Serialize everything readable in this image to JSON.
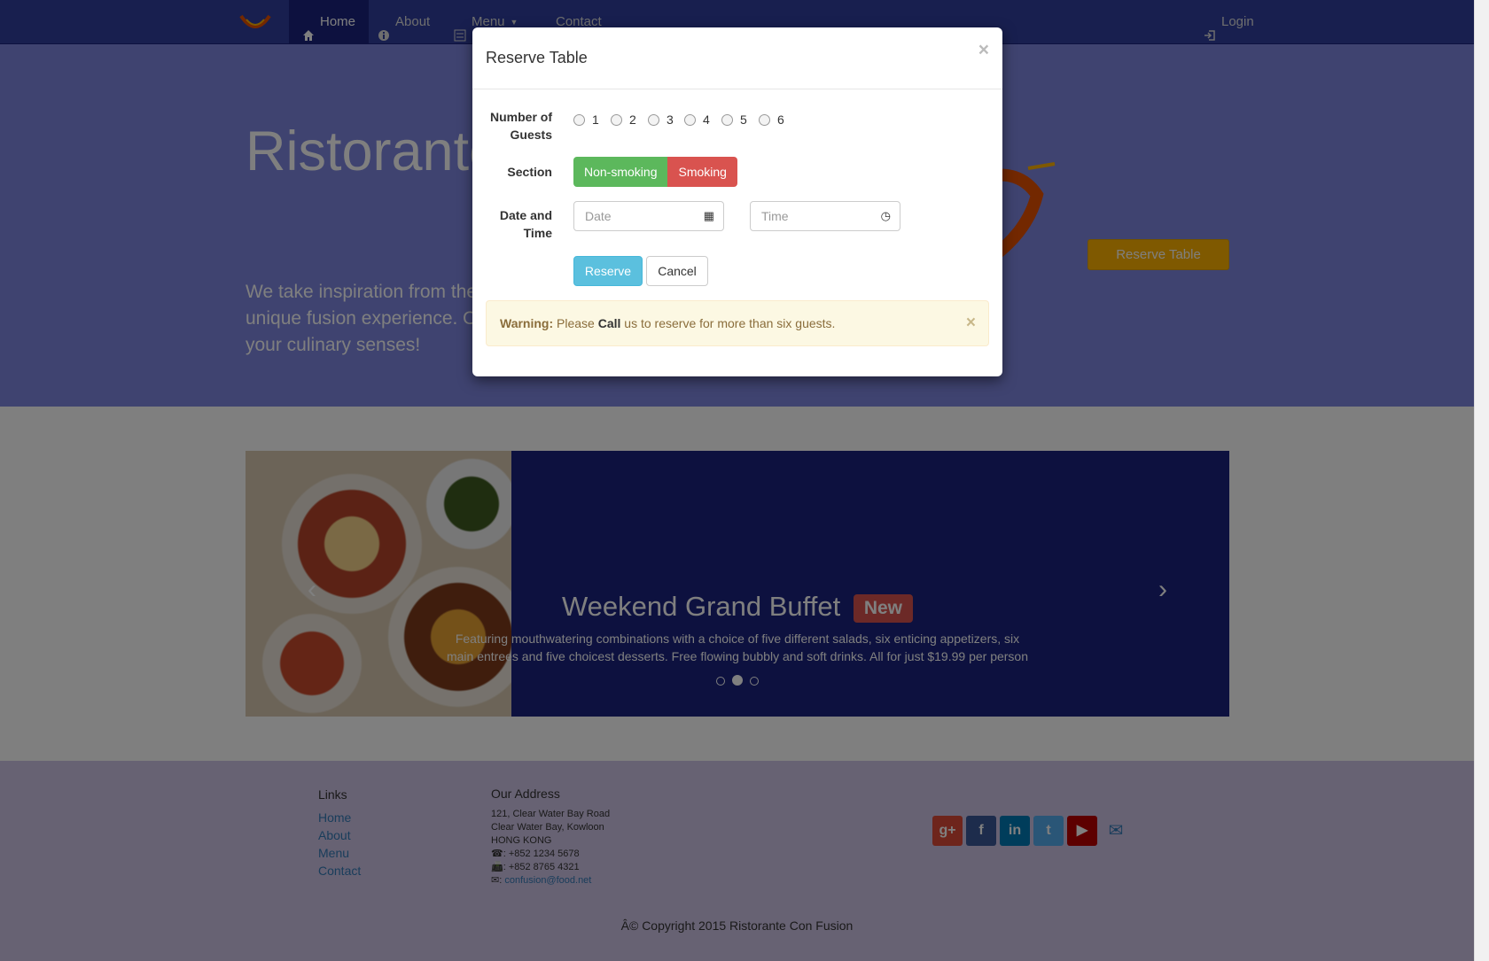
{
  "navbar": {
    "items": [
      {
        "label": "Home",
        "icon": "home-icon"
      },
      {
        "label": "About",
        "icon": "info-icon"
      },
      {
        "label": "Menu",
        "icon": "list-icon"
      },
      {
        "label": "Contact",
        "icon": "envelope-icon"
      }
    ],
    "login": "Login"
  },
  "jumbotron": {
    "title": "Ristorante Con Fusion",
    "text": "We take inspiration from the World's best cuisines, and create a unique fusion experience. Our lipsmacking creations will tickle your culinary senses!",
    "reserve_button": "Reserve Table"
  },
  "carousel": {
    "title": "Weekend Grand Buffet",
    "badge": "New",
    "text": "Featuring mouthwatering combinations with a choice of five different salads, six enticing appetizers, six main entrees and five choicest desserts. Free flowing bubbly and soft drinks. All for just $19.99 per person"
  },
  "footer": {
    "links_heading": "Links",
    "links": [
      "Home",
      "About",
      "Menu",
      "Contact"
    ],
    "address_heading": "Our Address",
    "address": [
      "121, Clear Water Bay Road",
      "Clear Water Bay, Kowloon",
      "HONG KONG"
    ],
    "phone": ": +852 1234 5678",
    "fax": ": +852 8765 4321",
    "email": "confusion@food.net",
    "copyright": "Â© Copyright 2015 Ristorante Con Fusion",
    "social": [
      "google-plus-icon",
      "facebook-icon",
      "linkedin-icon",
      "twitter-icon",
      "youtube-icon",
      "envelope-icon"
    ]
  },
  "modal": {
    "title": "Reserve Table",
    "close": "×",
    "guests_label": "Number of Guests",
    "guest_options": [
      "1",
      "2",
      "3",
      "4",
      "5",
      "6"
    ],
    "section_label": "Section",
    "section_options": [
      "Non-smoking",
      "Smoking"
    ],
    "datetime_label": "Date and Time",
    "date_placeholder": "Date",
    "time_placeholder": "Time",
    "reserve": "Reserve",
    "cancel": "Cancel",
    "alert": {
      "strong": "Warning:",
      "pre": " Please ",
      "call": "Call",
      "post": " us to reserve for more than six guests."
    }
  },
  "colors": {
    "primary": "#303f9f",
    "dark": "#1a237e",
    "accent": "#ffb300",
    "success": "#5cb85c",
    "danger": "#d9534f",
    "info": "#5bc0de"
  }
}
